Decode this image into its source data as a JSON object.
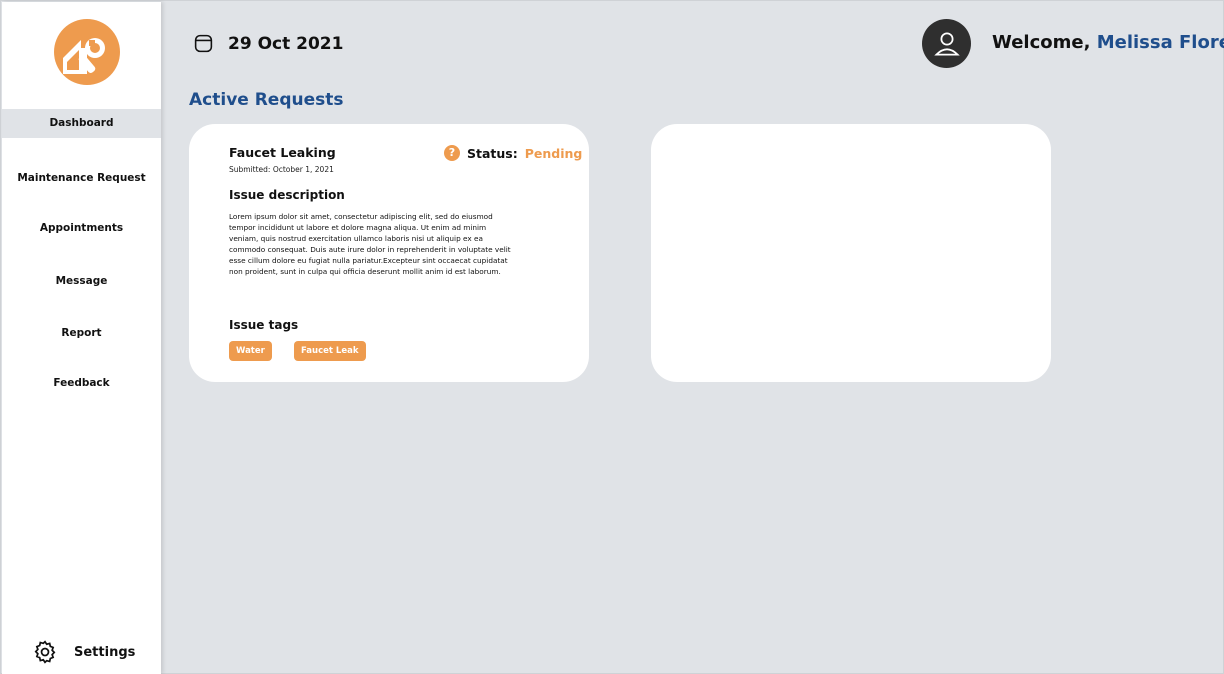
{
  "header": {
    "date": "29 Oct 2021",
    "welcome_prefix": "Welcome, ",
    "user_name": "Melissa Flores"
  },
  "sidebar": {
    "items": [
      {
        "label": "Dashboard",
        "active": true
      },
      {
        "label": "Maintenance Request"
      },
      {
        "label": "Appointments"
      },
      {
        "label": "Message"
      },
      {
        "label": "Report"
      },
      {
        "label": "Feedback"
      }
    ],
    "settings_label": "Settings"
  },
  "main": {
    "section_title": "Active Requests",
    "requests": [
      {
        "title": "Faucet Leaking",
        "submitted": "Submitted:  October 1, 2021",
        "status_label": "Status:",
        "status_value": "Pending",
        "description_heading": "Issue description",
        "description": "Lorem ipsum dolor sit amet, consectetur adipiscing elit, sed do eiusmod tempor incididunt ut labore et dolore magna aliqua. Ut enim ad minim veniam, quis nostrud exercitation ullamco laboris nisi ut aliquip ex ea commodo consequat. Duis aute irure dolor in reprehenderit in voluptate velit esse cillum dolore eu fugiat nulla pariatur.Excepteur sint occaecat cupidatat non proident, sunt in culpa qui officia deserunt mollit anim id est laborum.",
        "tags_heading": "Issue tags",
        "tags": [
          "Water",
          "Faucet Leak"
        ]
      }
    ]
  },
  "colors": {
    "accent_orange": "#ee9b4e",
    "brand_blue": "#1f4e8c",
    "background": "#e0e3e7"
  },
  "icons": [
    "logo-icon",
    "calendar-icon",
    "user-icon",
    "gear-icon",
    "help-icon"
  ]
}
